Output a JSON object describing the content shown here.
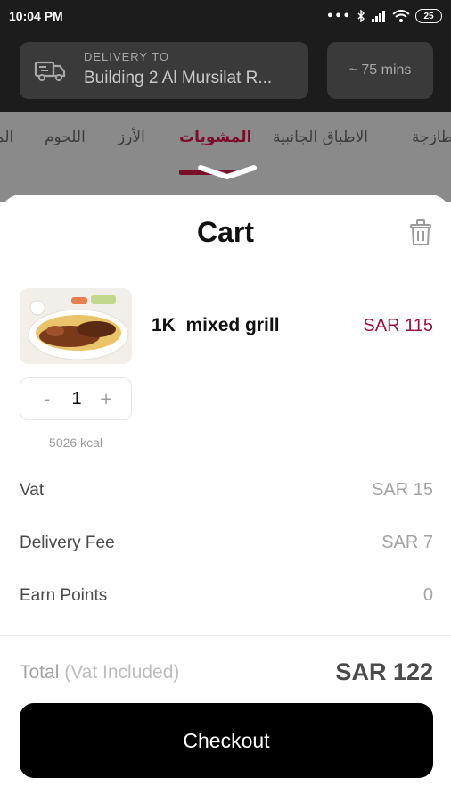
{
  "status_bar": {
    "time": "10:04 PM",
    "battery": "25"
  },
  "header": {
    "delivery_label": "DELIVERY TO",
    "delivery_address": "Building 2 Al Mursilat R...",
    "eta": "~ 75 mins"
  },
  "categories": [
    "طازجة",
    "الاطباق الجانبية",
    "المشويات",
    "الأرز",
    "اللحوم",
    "الم"
  ],
  "active_category": "المشويات",
  "cart": {
    "title": "Cart",
    "item": {
      "name": "1K  mixed grill",
      "price": "SAR 115",
      "quantity": "1",
      "minus": "-",
      "plus": "+",
      "calories": "5026 kcal"
    },
    "summary": {
      "vat_label": "Vat",
      "vat_value": "SAR 15",
      "delivery_label": "Delivery Fee",
      "delivery_value": "SAR 7",
      "points_label": "Earn Points",
      "points_value": "0"
    },
    "total_label": "Total",
    "total_note": "(Vat Included)",
    "total_value": "SAR 122",
    "checkout_label": "Checkout"
  },
  "colors": {
    "accent": "#9a1040",
    "category_active": "#7a0e2a",
    "button": "#000000"
  }
}
